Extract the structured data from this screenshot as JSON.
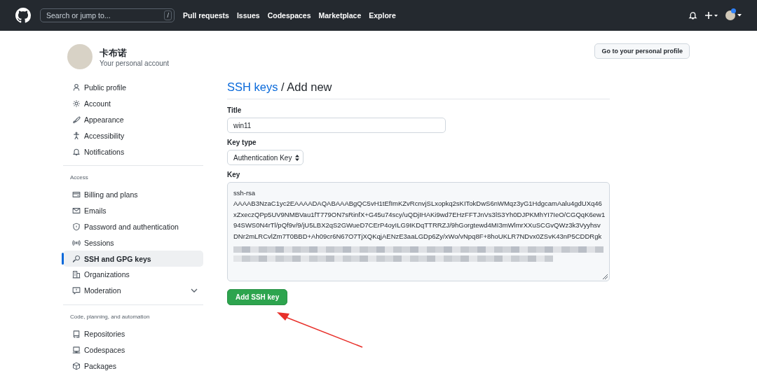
{
  "navbar": {
    "search": {
      "placeholder": "Search or jump to...",
      "shortcut": "/"
    },
    "links": [
      "Pull requests",
      "Issues",
      "Codespaces",
      "Marketplace",
      "Explore"
    ],
    "has_notification": true
  },
  "account": {
    "name": "卡布诺",
    "subtitle": "Your personal account",
    "profile_button": "Go to your personal profile"
  },
  "sidebar": {
    "sections": [
      {
        "items": [
          {
            "label": "Public profile",
            "selected": false
          },
          {
            "label": "Account",
            "selected": false
          },
          {
            "label": "Appearance",
            "selected": false
          },
          {
            "label": "Accessibility",
            "selected": false
          },
          {
            "label": "Notifications",
            "selected": false
          }
        ]
      },
      {
        "heading": "Access",
        "items": [
          {
            "label": "Billing and plans",
            "selected": false
          },
          {
            "label": "Emails",
            "selected": false
          },
          {
            "label": "Password and authentication",
            "selected": false
          },
          {
            "label": "Sessions",
            "selected": false
          },
          {
            "label": "SSH and GPG keys",
            "selected": true
          },
          {
            "label": "Organizations",
            "selected": false
          },
          {
            "label": "Moderation",
            "selected": false,
            "expanded": false
          }
        ]
      },
      {
        "heading": "Code, planning, and automation",
        "items": [
          {
            "label": "Repositories",
            "selected": false
          },
          {
            "label": "Codespaces",
            "selected": false
          },
          {
            "label": "Packages",
            "selected": false
          }
        ]
      }
    ]
  },
  "main": {
    "breadcrumb_link": "SSH keys",
    "heading": "/ Add new",
    "form": {
      "title_label": "Title",
      "title_value": "win11",
      "key_type_label": "Key type",
      "key_type_value": "Authentication Key",
      "key_label": "Key",
      "key_lines": [
        "ssh-rsa",
        "AAAAB3NzaC1yc2EAAAADAQABAAABgQC5vH1tEfImKZvRcnvjSLxopkq2sKITokDwS6nWMqz3yG1HdgcamAalu4gdUXq46",
        "xZxeczQPp5UV9NMBVau1fT779ON7sRinfX+G45u74scy/uQDjIHAKi9wd7EHzFFTJnVs3lS3Yh0DJPKMhYI7IeO/CGQqK6ew1",
        "94SWS0N4rTl/pQf9v/9/jU5LBX2qS2GWueD7CErP4oyILG9IKDqTTRRZJ/9hGorgtewd4MI3mWlmrXXuSCGvQWz3k3Vyyhsv",
        "DNr2mLRCvlZm7T0BBD+Ah09cr6N67O7TjXQKqjAENzE3aaLGDp6Zy/xWo/vNpq8F+8hoUKLR7NDvx0ZSvK43nP5CDDRgk"
      ],
      "key_redacted": true,
      "submit": "Add SSH key"
    }
  }
}
